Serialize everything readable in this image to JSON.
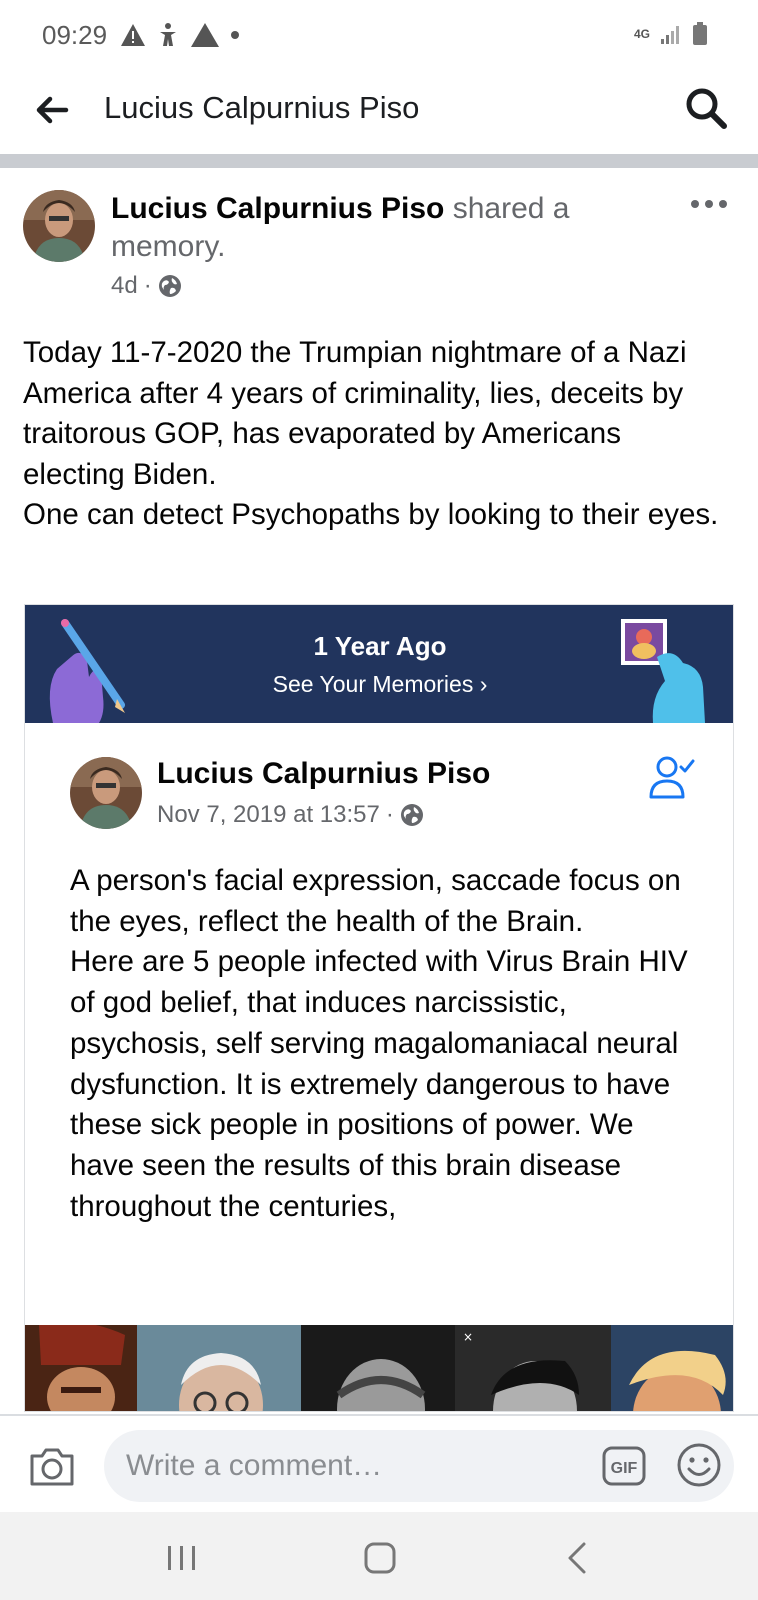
{
  "status_bar": {
    "time": "09:29",
    "network": "4G",
    "left_icons": [
      "warning-icon",
      "accessibility-icon",
      "alert-triangle-icon",
      "dot-icon"
    ],
    "right_icons": [
      "network-icon",
      "signal-icon",
      "battery-icon"
    ]
  },
  "app_bar": {
    "title": "Lucius Calpurnius Piso"
  },
  "post": {
    "author": "Lucius Calpurnius Piso",
    "action": " shared a memory.",
    "time": "4d",
    "separator": "·",
    "privacy": "public",
    "text": "Today 11-7-2020 the Trumpian nightmare of a Nazi America after 4 years of criminality, lies, deceits by traitorous GOP, has evaporated by Americans electing Biden.\nOne can detect Psychopaths by looking to their eyes."
  },
  "memory": {
    "banner_title": "1 Year Ago",
    "banner_link": "See Your Memories ›",
    "author": "Lucius Calpurnius Piso",
    "date": "Nov 7, 2019 at 13:57",
    "separator": "·",
    "text": "A person's facial expression, saccade focus on the eyes, reflect the health of the Brain.\nHere are 5 people infected with Virus Brain HIV of god belief, that induces narcissistic, psychosis, self serving magalomaniacal neural dysfunction. It is extremely dangerous to have these sick people in positions of power. We have seen the results of this brain disease throughout the centuries,",
    "photo_count": 5
  },
  "comment_bar": {
    "placeholder": "Write a comment…",
    "gif_label": "GIF"
  },
  "colors": {
    "banner_bg": "#21345d",
    "facebook_blue": "#1877f2",
    "text": "#050505",
    "muted": "#65676b"
  }
}
